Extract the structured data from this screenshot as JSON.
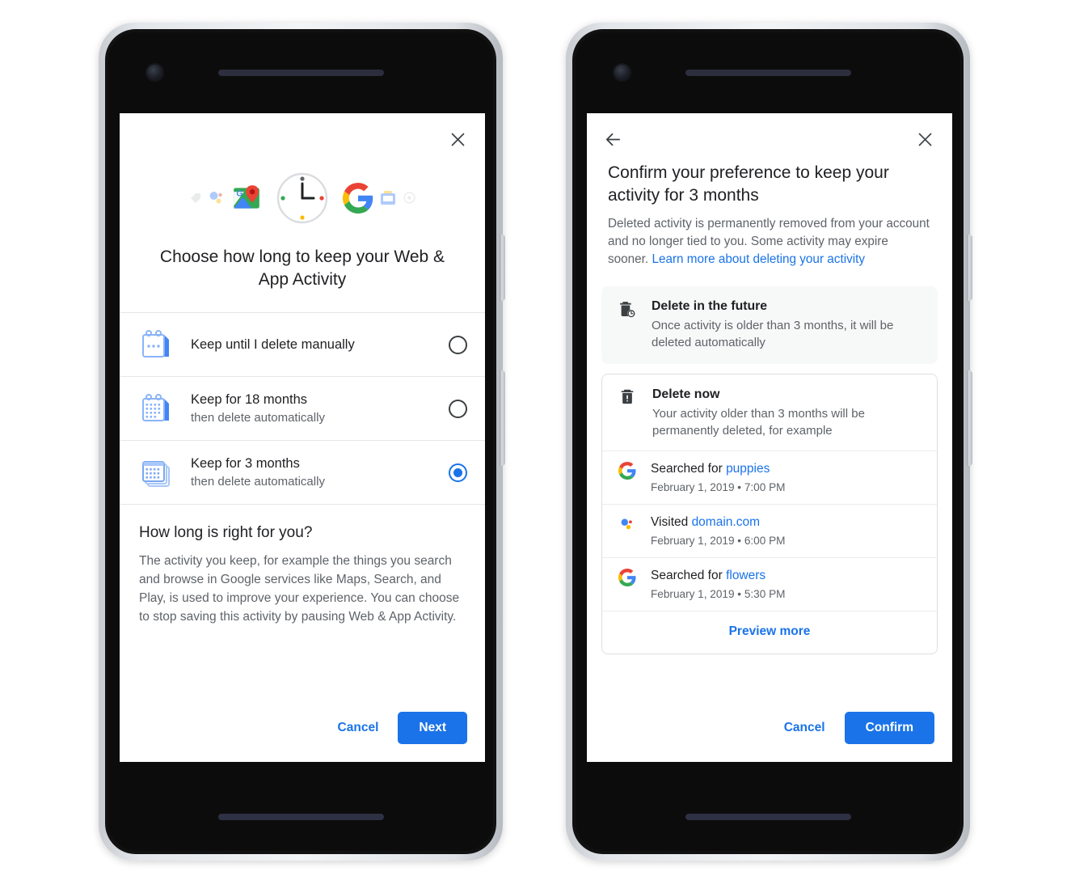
{
  "left_phone": {
    "screen_name": "choose-retention-screen",
    "close_label": "×",
    "hero_icons": [
      "tag-icon",
      "assistant-dots-icon",
      "maps-icon",
      "clock-icon",
      "google-g-icon",
      "news-icon",
      "photos-icon"
    ],
    "headline": "Choose how long to keep your Web & App Activity",
    "options": [
      {
        "title": "Keep until I delete manually",
        "subtitle": "",
        "icon": "calendar-single-icon",
        "selected": false
      },
      {
        "title": "Keep for 18 months",
        "subtitle": "then delete automatically",
        "icon": "calendar-month-icon",
        "selected": false
      },
      {
        "title": "Keep for 3 months",
        "subtitle": "then delete automatically",
        "icon": "calendar-stack-icon",
        "selected": true
      }
    ],
    "explainer": {
      "heading": "How long is right for you?",
      "body": "The activity you keep, for example the things you search and browse in Google services like Maps, Search, and Play, is used to improve your experience. You can choose to stop saving this activity by pausing Web & App Activity."
    },
    "cancel_label": "Cancel",
    "primary_label": "Next"
  },
  "right_phone": {
    "screen_name": "confirm-preference-screen",
    "back_label": "←",
    "close_label": "×",
    "title": "Confirm your preference to keep your activity for 3 months",
    "description_prefix": "Deleted activity is permanently removed from your account and no longer tied to you. Some activity may expire sooner. ",
    "description_link": "Learn more about deleting your activity",
    "future_card": {
      "icon": "trash-clock-icon",
      "title": "Delete in the future",
      "body": "Once activity is older than 3 months, it will be deleted automatically"
    },
    "now_card": {
      "icon": "trash-icon",
      "title": "Delete now",
      "body": "Your activity older than 3 months will be permanently deleted, for example"
    },
    "activities": [
      {
        "icon": "google-g-icon",
        "prefix": "Searched for ",
        "highlight": "puppies",
        "timestamp": "February 1, 2019 • 7:00 PM"
      },
      {
        "icon": "assistant-dots-icon",
        "prefix": "Visited ",
        "highlight": "domain.com",
        "timestamp": "February 1, 2019 • 6:00 PM"
      },
      {
        "icon": "google-g-icon",
        "prefix": "Searched for ",
        "highlight": "flowers",
        "timestamp": "February 1, 2019 • 5:30 PM"
      }
    ],
    "preview_more_label": "Preview more",
    "cancel_label": "Cancel",
    "primary_label": "Confirm"
  },
  "colors": {
    "accent_blue": "#1a73e8",
    "text_primary": "#202124",
    "text_secondary": "#5f6368",
    "card_gray": "#f7f8f8",
    "phone_body": "#0c0c0c"
  }
}
